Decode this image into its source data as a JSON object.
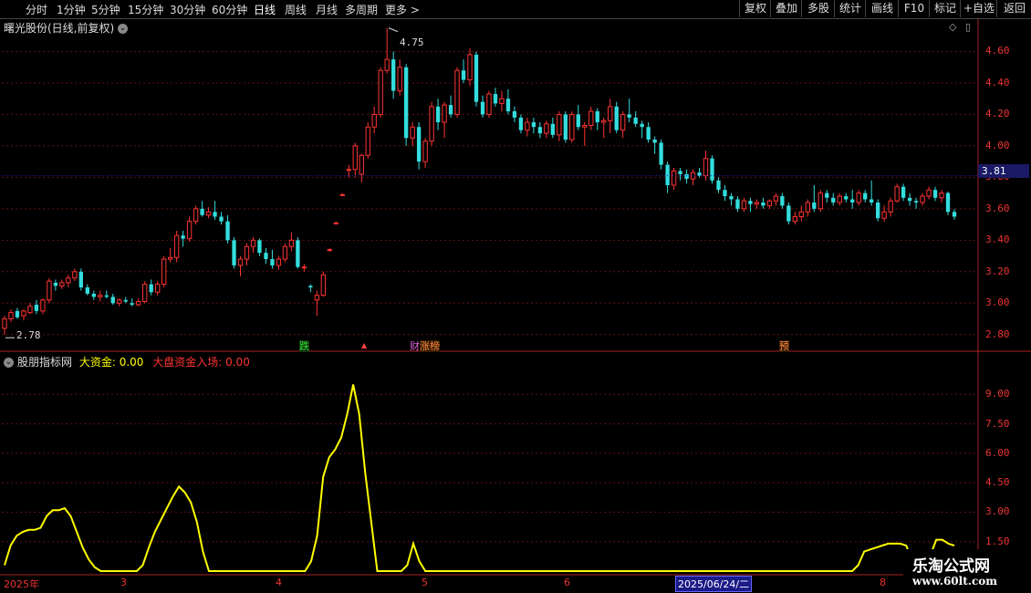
{
  "toolbar": {
    "timeframes": [
      "分时",
      "1分钟",
      "5分钟",
      "15分钟",
      "30分钟",
      "60分钟",
      "日线",
      "周线",
      "月线",
      "多周期",
      "更多 >"
    ],
    "active_timeframe": "日线",
    "right_buttons": [
      "复权",
      "叠加",
      "多股",
      "统计",
      "画线",
      "F10",
      "标记",
      "+自选",
      "返回"
    ]
  },
  "chart": {
    "title": "曙光股份(日线,前复权)",
    "current_price": "3.81",
    "high_label": "4.75",
    "low_label": "2.78",
    "price_axis": [
      "4.60",
      "4.40",
      "4.20",
      "4.00",
      "3.80",
      "3.60",
      "3.40",
      "3.20",
      "3.00",
      "2.80"
    ],
    "markers": [
      {
        "text": "跌",
        "color": "#33dd33"
      },
      {
        "text": "▲",
        "color": "#ff4444"
      },
      {
        "text": "财",
        "color": "#dd66dd"
      },
      {
        "text": "涨榜",
        "color": "#ff8844"
      },
      {
        "text": "预",
        "color": "#ff8844"
      }
    ]
  },
  "indicator": {
    "name": "股朋指标网",
    "label1": "大资金: 0.00",
    "label2": "大盘资金入场: 0.00",
    "axis": [
      "9.00",
      "7.50",
      "6.00",
      "4.50",
      "3.00",
      "1.50"
    ]
  },
  "xaxis": {
    "labels": [
      "2025年",
      "3",
      "4",
      "5",
      "6",
      "2025/06/24/二",
      "8"
    ]
  },
  "watermark": {
    "line1": "乐淘公式网",
    "line2": "www.60lt.com"
  },
  "colors": {
    "up": "#ff3333",
    "down": "#33dddd",
    "line": "#ffff00",
    "grid": "#661111"
  },
  "chart_data": {
    "type": "line",
    "candles": [
      [
        2.84,
        2.92,
        2.8,
        2.9
      ],
      [
        2.9,
        2.96,
        2.88,
        2.94
      ],
      [
        2.95,
        2.97,
        2.9,
        2.91
      ],
      [
        2.92,
        2.96,
        2.89,
        2.95
      ],
      [
        2.94,
        3.0,
        2.93,
        2.98
      ],
      [
        2.99,
        3.02,
        2.93,
        2.95
      ],
      [
        2.95,
        3.03,
        2.93,
        3.02
      ],
      [
        3.02,
        3.16,
        3.0,
        3.14
      ],
      [
        3.13,
        3.15,
        3.08,
        3.11
      ],
      [
        3.11,
        3.15,
        3.09,
        3.13
      ],
      [
        3.13,
        3.18,
        3.1,
        3.16
      ],
      [
        3.16,
        3.22,
        3.14,
        3.2
      ],
      [
        3.2,
        3.22,
        3.08,
        3.1
      ],
      [
        3.1,
        3.12,
        3.05,
        3.06
      ],
      [
        3.06,
        3.08,
        3.02,
        3.04
      ],
      [
        3.04,
        3.08,
        3.01,
        3.05
      ],
      [
        3.05,
        3.08,
        3.03,
        3.04
      ],
      [
        3.04,
        3.06,
        2.99,
        3.0
      ],
      [
        3.0,
        3.03,
        2.98,
        3.02
      ],
      [
        3.02,
        3.04,
        3.0,
        3.01
      ],
      [
        3.0,
        3.03,
        2.98,
        2.99
      ],
      [
        2.99,
        3.03,
        2.98,
        3.01
      ],
      [
        3.01,
        3.14,
        3.0,
        3.12
      ],
      [
        3.12,
        3.15,
        3.05,
        3.07
      ],
      [
        3.07,
        3.14,
        3.05,
        3.12
      ],
      [
        3.12,
        3.3,
        3.1,
        3.28
      ],
      [
        3.28,
        3.35,
        3.26,
        3.29
      ],
      [
        3.29,
        3.46,
        3.26,
        3.43
      ],
      [
        3.43,
        3.46,
        3.36,
        3.41
      ],
      [
        3.41,
        3.55,
        3.39,
        3.52
      ],
      [
        3.52,
        3.62,
        3.5,
        3.6
      ],
      [
        3.6,
        3.65,
        3.55,
        3.56
      ],
      [
        3.56,
        3.61,
        3.54,
        3.58
      ],
      [
        3.58,
        3.65,
        3.53,
        3.55
      ],
      [
        3.55,
        3.58,
        3.5,
        3.52
      ],
      [
        3.52,
        3.56,
        3.38,
        3.4
      ],
      [
        3.4,
        3.42,
        3.22,
        3.24
      ],
      [
        3.24,
        3.3,
        3.17,
        3.28
      ],
      [
        3.28,
        3.38,
        3.24,
        3.36
      ],
      [
        3.36,
        3.42,
        3.32,
        3.4
      ],
      [
        3.4,
        3.41,
        3.3,
        3.32
      ],
      [
        3.32,
        3.35,
        3.25,
        3.28
      ],
      [
        3.28,
        3.34,
        3.22,
        3.24
      ],
      [
        3.24,
        3.3,
        3.21,
        3.28
      ],
      [
        3.28,
        3.38,
        3.26,
        3.36
      ],
      [
        3.36,
        3.45,
        3.33,
        3.4
      ],
      [
        3.4,
        3.42,
        3.22,
        3.23
      ],
      [
        3.23,
        3.25,
        3.2,
        3.23
      ],
      [
        3.11,
        3.12,
        3.07,
        3.1
      ],
      [
        3.02,
        3.08,
        2.92,
        3.05
      ],
      [
        3.05,
        3.2,
        3.04,
        3.18
      ],
      [
        3.34,
        3.35,
        3.33,
        3.34
      ],
      [
        3.51,
        3.52,
        3.5,
        3.51
      ],
      [
        3.69,
        3.7,
        3.68,
        3.69
      ],
      [
        3.85,
        3.88,
        3.8,
        3.85
      ],
      [
        3.85,
        4.02,
        3.8,
        4.0
      ],
      [
        3.82,
        3.95,
        3.77,
        3.94
      ],
      [
        3.94,
        4.15,
        3.92,
        4.12
      ],
      [
        4.12,
        4.25,
        4.08,
        4.2
      ],
      [
        4.2,
        4.5,
        4.18,
        4.48
      ],
      [
        4.48,
        4.75,
        4.46,
        4.55
      ],
      [
        4.55,
        4.6,
        4.3,
        4.35
      ],
      [
        4.35,
        4.55,
        4.32,
        4.5
      ],
      [
        4.5,
        4.52,
        4.0,
        4.05
      ],
      [
        4.05,
        4.15,
        4.0,
        4.12
      ],
      [
        4.12,
        4.15,
        3.85,
        3.9
      ],
      [
        3.9,
        4.05,
        3.86,
        4.03
      ],
      [
        4.03,
        4.28,
        4.0,
        4.25
      ],
      [
        4.25,
        4.3,
        4.1,
        4.15
      ],
      [
        4.15,
        4.28,
        4.05,
        4.26
      ],
      [
        4.26,
        4.32,
        4.18,
        4.2
      ],
      [
        4.2,
        4.5,
        4.18,
        4.48
      ],
      [
        4.48,
        4.55,
        4.4,
        4.42
      ],
      [
        4.42,
        4.62,
        4.38,
        4.58
      ],
      [
        4.58,
        4.6,
        4.25,
        4.28
      ],
      [
        4.28,
        4.32,
        4.18,
        4.2
      ],
      [
        4.2,
        4.35,
        4.18,
        4.33
      ],
      [
        4.33,
        4.37,
        4.25,
        4.27
      ],
      [
        4.27,
        4.35,
        4.22,
        4.3
      ],
      [
        4.3,
        4.36,
        4.2,
        4.22
      ],
      [
        4.22,
        4.25,
        4.15,
        4.18
      ],
      [
        4.18,
        4.2,
        4.08,
        4.1
      ],
      [
        4.1,
        4.18,
        4.06,
        4.15
      ],
      [
        4.15,
        4.18,
        4.08,
        4.12
      ],
      [
        4.12,
        4.15,
        4.05,
        4.08
      ],
      [
        4.08,
        4.16,
        4.05,
        4.14
      ],
      [
        4.14,
        4.18,
        4.05,
        4.07
      ],
      [
        4.07,
        4.22,
        4.03,
        4.2
      ],
      [
        4.2,
        4.22,
        4.02,
        4.04
      ],
      [
        4.04,
        4.22,
        4.02,
        4.2
      ],
      [
        4.2,
        4.26,
        4.1,
        4.12
      ],
      [
        4.12,
        4.15,
        4.0,
        4.13
      ],
      [
        4.13,
        4.25,
        4.1,
        4.22
      ],
      [
        4.22,
        4.24,
        4.1,
        4.15
      ],
      [
        4.15,
        4.18,
        4.05,
        4.16
      ],
      [
        4.16,
        4.3,
        4.08,
        4.25
      ],
      [
        4.25,
        4.28,
        4.08,
        4.1
      ],
      [
        4.1,
        4.22,
        4.05,
        4.2
      ],
      [
        4.2,
        4.3,
        4.15,
        4.18
      ],
      [
        4.18,
        4.22,
        4.12,
        4.14
      ],
      [
        4.14,
        4.16,
        4.05,
        4.12
      ],
      [
        4.12,
        4.15,
        4.02,
        4.04
      ],
      [
        4.04,
        4.06,
        3.95,
        4.02
      ],
      [
        4.02,
        4.04,
        3.85,
        3.88
      ],
      [
        3.88,
        3.9,
        3.7,
        3.75
      ],
      [
        3.75,
        3.86,
        3.72,
        3.84
      ],
      [
        3.84,
        3.86,
        3.78,
        3.82
      ],
      [
        3.82,
        3.85,
        3.76,
        3.79
      ],
      [
        3.79,
        3.85,
        3.75,
        3.83
      ],
      [
        3.83,
        3.86,
        3.8,
        3.81
      ],
      [
        3.81,
        3.97,
        3.78,
        3.92
      ],
      [
        3.92,
        3.94,
        3.76,
        3.78
      ],
      [
        3.78,
        3.8,
        3.7,
        3.72
      ],
      [
        3.72,
        3.75,
        3.65,
        3.68
      ],
      [
        3.68,
        3.7,
        3.62,
        3.66
      ],
      [
        3.66,
        3.68,
        3.58,
        3.6
      ],
      [
        3.6,
        3.67,
        3.58,
        3.65
      ],
      [
        3.65,
        3.67,
        3.58,
        3.63
      ],
      [
        3.63,
        3.66,
        3.6,
        3.64
      ],
      [
        3.64,
        3.67,
        3.6,
        3.62
      ],
      [
        3.62,
        3.66,
        3.6,
        3.65
      ],
      [
        3.65,
        3.7,
        3.62,
        3.68
      ],
      [
        3.68,
        3.7,
        3.6,
        3.62
      ],
      [
        3.62,
        3.64,
        3.5,
        3.52
      ],
      [
        3.52,
        3.58,
        3.5,
        3.55
      ],
      [
        3.55,
        3.62,
        3.52,
        3.58
      ],
      [
        3.58,
        3.66,
        3.55,
        3.64
      ],
      [
        3.64,
        3.75,
        3.58,
        3.6
      ],
      [
        3.6,
        3.72,
        3.58,
        3.7
      ],
      [
        3.7,
        3.72,
        3.64,
        3.67
      ],
      [
        3.67,
        3.7,
        3.62,
        3.64
      ],
      [
        3.64,
        3.7,
        3.62,
        3.68
      ],
      [
        3.68,
        3.7,
        3.64,
        3.66
      ],
      [
        3.66,
        3.72,
        3.6,
        3.64
      ],
      [
        3.64,
        3.72,
        3.62,
        3.7
      ],
      [
        3.7,
        3.72,
        3.64,
        3.66
      ],
      [
        3.66,
        3.78,
        3.62,
        3.64
      ],
      [
        3.64,
        3.66,
        3.52,
        3.54
      ],
      [
        3.54,
        3.62,
        3.52,
        3.58
      ],
      [
        3.58,
        3.67,
        3.55,
        3.65
      ],
      [
        3.65,
        3.76,
        3.64,
        3.74
      ],
      [
        3.74,
        3.76,
        3.65,
        3.67
      ],
      [
        3.67,
        3.7,
        3.62,
        3.65
      ],
      [
        3.65,
        3.67,
        3.6,
        3.64
      ],
      [
        3.64,
        3.7,
        3.62,
        3.68
      ],
      [
        3.68,
        3.74,
        3.66,
        3.72
      ],
      [
        3.72,
        3.74,
        3.65,
        3.67
      ],
      [
        3.67,
        3.72,
        3.64,
        3.7
      ],
      [
        3.7,
        3.71,
        3.56,
        3.58
      ],
      [
        3.58,
        3.6,
        3.53,
        3.55
      ]
    ],
    "indicator_values": [
      0.3,
      1.3,
      1.8,
      2.0,
      2.1,
      2.1,
      2.2,
      2.8,
      3.1,
      3.1,
      3.2,
      2.8,
      2.0,
      1.2,
      0.6,
      0.2,
      0.0,
      0.0,
      0.0,
      0.0,
      0.0,
      0.0,
      0.0,
      0.3,
      1.2,
      2.0,
      2.6,
      3.2,
      3.8,
      4.3,
      4.0,
      3.5,
      2.5,
      1.0,
      0.0,
      0.0,
      0.0,
      0.0,
      0.0,
      0.0,
      0.0,
      0.0,
      0.0,
      0.0,
      0.0,
      0.0,
      0.0,
      0.0,
      0.0,
      0.0,
      0.0,
      0.5,
      1.8,
      4.8,
      5.8,
      6.2,
      6.8,
      8.0,
      9.5,
      8.0,
      5.0,
      2.5,
      0.0,
      0.0,
      0.0,
      0.0,
      0.0,
      0.3,
      1.4,
      0.5,
      0.0,
      0.0,
      0.0,
      0.0,
      0.0,
      0.0,
      0.0,
      0.0,
      0.0,
      0.0,
      0.0,
      0.0,
      0.0,
      0.0,
      0.0,
      0.0,
      0.0,
      0.0,
      0.0,
      0.0,
      0.0,
      0.0,
      0.0,
      0.0,
      0.0,
      0.0,
      0.0,
      0.0,
      0.0,
      0.0,
      0.0,
      0.0,
      0.0,
      0.0,
      0.0,
      0.0,
      0.0,
      0.0,
      0.0,
      0.0,
      0.0,
      0.0,
      0.0,
      0.0,
      0.0,
      0.0,
      0.0,
      0.0,
      0.0,
      0.0,
      0.0,
      0.0,
      0.0,
      0.0,
      0.0,
      0.0,
      0.0,
      0.0,
      0.0,
      0.0,
      0.0,
      0.0,
      0.0,
      0.0,
      0.0,
      0.0,
      0.0,
      0.0,
      0.0,
      0.0,
      0.0,
      0.0,
      0.3,
      1.0,
      1.1,
      1.2,
      1.3,
      1.4,
      1.4,
      1.4,
      1.3,
      0.5,
      0.1,
      0.3,
      0.8,
      1.6,
      1.6,
      1.4,
      1.3
    ],
    "price_ylim": [
      2.7,
      4.8
    ],
    "indicator_ylim": [
      0,
      10.5
    ],
    "grid": true
  }
}
